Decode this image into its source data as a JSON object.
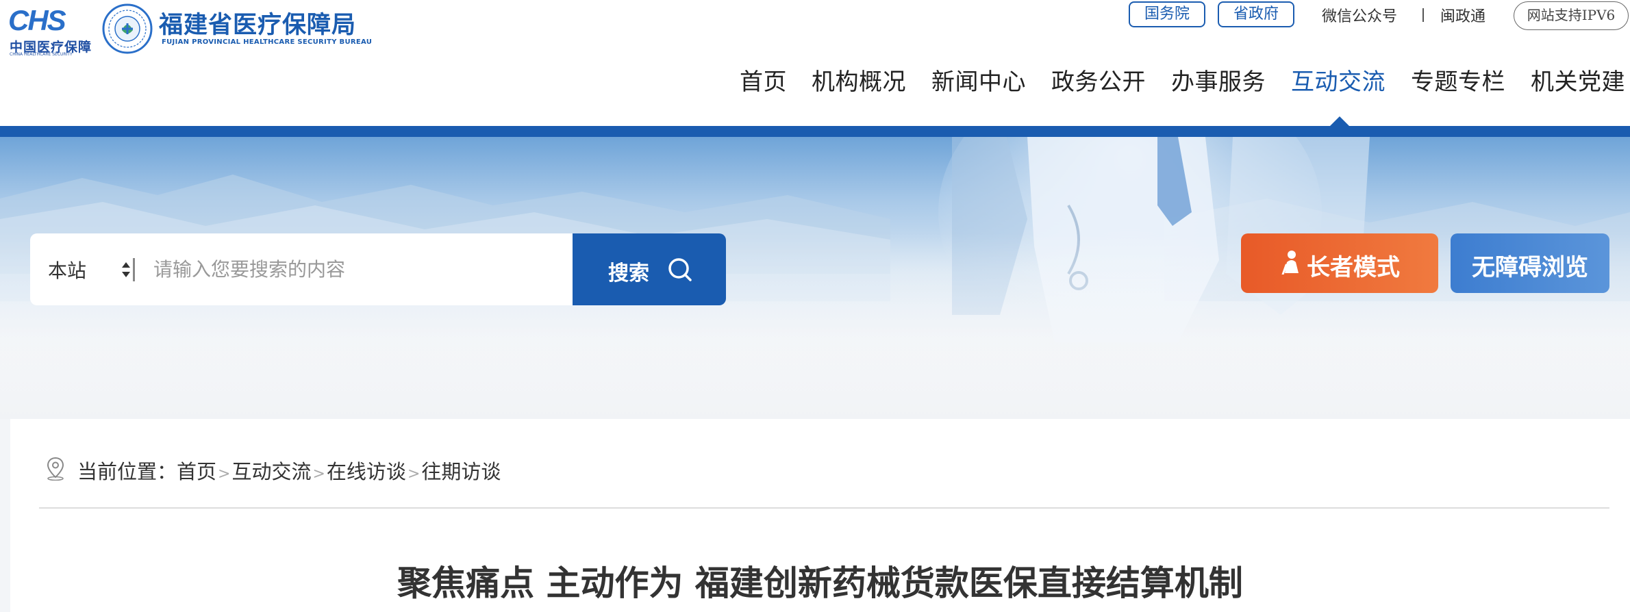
{
  "logo": {
    "chs_mark": "CHS",
    "chs_cn": "中国医疗保障",
    "chs_en": "CHINA HEALTHCARE SECURITY",
    "bureau_name_cn": "福建省医疗保障局",
    "bureau_name_en": "FUJIAN PROVINCIAL HEALTHCARE SECURITY BUREAU"
  },
  "top_links": {
    "guowuyuan": "国务院",
    "shengzhengfu": "省政府",
    "wechat": "微信公众号",
    "minzhengtong": "闽政通",
    "ipv6": "网站支持IPV6"
  },
  "nav": {
    "items": [
      "首页",
      "机构概况",
      "新闻中心",
      "政务公开",
      "办事服务",
      "互动交流",
      "专题专栏",
      "机关党建"
    ],
    "active": "互动交流"
  },
  "search": {
    "scope": "本站",
    "placeholder": "请输入您要搜索的内容",
    "button_label": "搜索"
  },
  "modes": {
    "elder": "长者模式",
    "accessible": "无障碍浏览"
  },
  "breadcrumb": {
    "prefix": "当前位置：",
    "items": [
      "首页",
      "互动交流",
      "在线访谈",
      "往期访谈"
    ],
    "separator": ">"
  },
  "article": {
    "title": "聚焦痛点 主动作为 福建创新药械货款医保直接结算机制"
  },
  "colors": {
    "brand_blue": "#1a5cb0",
    "elder_orange": "#e85a28",
    "accessible_blue": "#4a88d4"
  }
}
